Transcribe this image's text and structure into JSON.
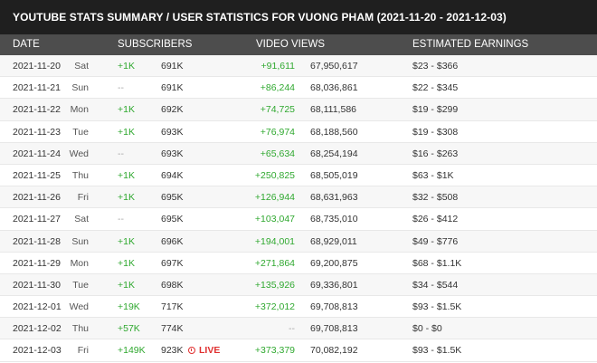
{
  "title": "YOUTUBE STATS SUMMARY / USER STATISTICS FOR VUONG PHAM (2021-11-20 - 2021-12-03)",
  "headers": {
    "date": "DATE",
    "subscribers": "SUBSCRIBERS",
    "video_views": "VIDEO VIEWS",
    "estimated_earnings": "ESTIMATED EARNINGS"
  },
  "live_label": "LIVE",
  "rows": [
    {
      "date": "2021-11-20",
      "day": "Sat",
      "sub_delta": "+1K",
      "sub_total": "691K",
      "view_delta": "+91,611",
      "view_total": "67,950,617",
      "earn": "$23  -  $366"
    },
    {
      "date": "2021-11-21",
      "day": "Sun",
      "sub_delta": "--",
      "sub_total": "691K",
      "view_delta": "+86,244",
      "view_total": "68,036,861",
      "earn": "$22  -  $345"
    },
    {
      "date": "2021-11-22",
      "day": "Mon",
      "sub_delta": "+1K",
      "sub_total": "692K",
      "view_delta": "+74,725",
      "view_total": "68,111,586",
      "earn": "$19  -  $299"
    },
    {
      "date": "2021-11-23",
      "day": "Tue",
      "sub_delta": "+1K",
      "sub_total": "693K",
      "view_delta": "+76,974",
      "view_total": "68,188,560",
      "earn": "$19  -  $308"
    },
    {
      "date": "2021-11-24",
      "day": "Wed",
      "sub_delta": "--",
      "sub_total": "693K",
      "view_delta": "+65,634",
      "view_total": "68,254,194",
      "earn": "$16  -  $263"
    },
    {
      "date": "2021-11-25",
      "day": "Thu",
      "sub_delta": "+1K",
      "sub_total": "694K",
      "view_delta": "+250,825",
      "view_total": "68,505,019",
      "earn": "$63  -  $1K"
    },
    {
      "date": "2021-11-26",
      "day": "Fri",
      "sub_delta": "+1K",
      "sub_total": "695K",
      "view_delta": "+126,944",
      "view_total": "68,631,963",
      "earn": "$32  -  $508"
    },
    {
      "date": "2021-11-27",
      "day": "Sat",
      "sub_delta": "--",
      "sub_total": "695K",
      "view_delta": "+103,047",
      "view_total": "68,735,010",
      "earn": "$26  -  $412"
    },
    {
      "date": "2021-11-28",
      "day": "Sun",
      "sub_delta": "+1K",
      "sub_total": "696K",
      "view_delta": "+194,001",
      "view_total": "68,929,011",
      "earn": "$49  -  $776"
    },
    {
      "date": "2021-11-29",
      "day": "Mon",
      "sub_delta": "+1K",
      "sub_total": "697K",
      "view_delta": "+271,864",
      "view_total": "69,200,875",
      "earn": "$68  -  $1.1K"
    },
    {
      "date": "2021-11-30",
      "day": "Tue",
      "sub_delta": "+1K",
      "sub_total": "698K",
      "view_delta": "+135,926",
      "view_total": "69,336,801",
      "earn": "$34  -  $544"
    },
    {
      "date": "2021-12-01",
      "day": "Wed",
      "sub_delta": "+19K",
      "sub_total": "717K",
      "view_delta": "+372,012",
      "view_total": "69,708,813",
      "earn": "$93  -  $1.5K"
    },
    {
      "date": "2021-12-02",
      "day": "Thu",
      "sub_delta": "+57K",
      "sub_total": "774K",
      "view_delta": "--",
      "view_total": "69,708,813",
      "earn": "$0  -  $0"
    },
    {
      "date": "2021-12-03",
      "day": "Fri",
      "sub_delta": "+149K",
      "sub_total": "923K",
      "view_delta": "+373,379",
      "view_total": "70,082,192",
      "earn": "$93  -  $1.5K",
      "live": true
    }
  ]
}
